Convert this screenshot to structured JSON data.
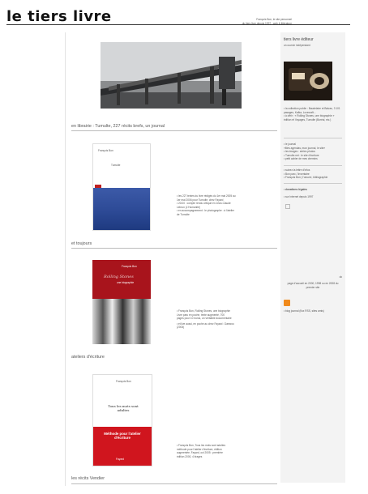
{
  "site": {
    "title": "le tiers livre",
    "tagline_1": "François Bon, le site personnel",
    "tagline_2": "du tiers livre depuis 1997 · web & littérature"
  },
  "sidebar": {
    "title": "tiers livre éditeur",
    "subtitle": "un ouvroir indépendant",
    "block1": [
      "• la collection publie : Baudelaire et Balzac, 3 101 pasages, Kafka, Lovecraft...",
      "• à offrir : « Rolling Stones, une biographie »",
      "édition et Voyages, Tumulte (Boréal, etc.)"
    ],
    "block2": [
      "• le journal",
      "«Mes agendas, mon journal, le site»",
      "• les images : séries photos",
      "• Tumulte.net : le site d'écriture",
      "• petit cahier de mes chemins"
    ],
    "block3": [
      "• suivez la lettre d'infos",
      "• Bon parc, l'inventaire",
      "• François Bon | l'oeuvre, bibliographie"
    ],
    "block4_title": "• donations légales",
    "block4": [
      "• sur Internet depuis 1997"
    ],
    "footer_short": "ok",
    "footer": [
      "page d'accueil en 2000, 1998 ou en 2008 du",
      "premier site"
    ],
    "rss": "• blog journal (flux RSS, sites amis)"
  },
  "sections": [
    {
      "title": "en librairie : Tumulte, 227 récits brefs, un journal",
      "cover_author": "François Bon",
      "cover_title": "Tumulte",
      "text": [
        "• les 227 textes du livre rédigés du 1er mai 2005 au",
        "1er mai 2006 pour Tumulte, chez Fayard",
        "• 20/10 : compte rendu critique en Jean-Claude",
        "Lebrun (L'Humanité)",
        "• en accompagnement : le photographe : à l'atelier",
        "de Tumulte"
      ]
    },
    {
      "title": "et toujours",
      "cover_author": "François Bon",
      "cover_title": "Rolling Stones",
      "cover_subtitle": "une biographie",
      "text": [
        "• François Bon, Rolling Stones, une biographie",
        "Livre paru en poche, texte augmenté, 700",
        "pages pour 10 euros, un véritable documentaire",
        "• et live aussi, en poche au chez Fayard : Daewoo",
        "(2004)"
      ]
    },
    {
      "title": "ateliers d'écriture",
      "cover_author": "François Bon",
      "cover_title": "Tous les mots sont adultes",
      "cover_red_text": "Méthode pour l'atelier d'écriture",
      "cover_publisher": "Fayard",
      "text": [
        "• François Bon, Tous les mots sont adultes",
        "méthode pour l'atelier d'écriture, édition",
        "augmentée, Fayard, oct 2005 : première",
        "édition 2000, 4 tirages"
      ]
    },
    {
      "title": "les récits Vendier"
    }
  ]
}
